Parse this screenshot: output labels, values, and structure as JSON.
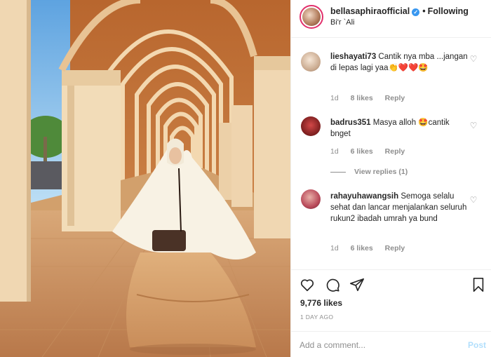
{
  "header": {
    "username": "bellasaphiraofficial",
    "separator": "•",
    "follow_status": "Following",
    "location": "Bi'r `Ali"
  },
  "comments": [
    {
      "username": "lieshayati73",
      "text": "Cantik nya mba ...jangan di lepas lagi yaa👏❤️❤️🤩",
      "time": "1d",
      "likes": "8 likes",
      "reply": "Reply"
    },
    {
      "username": "badrus351",
      "text": "Masya alloh 🤩cantik bnget",
      "time": "1d",
      "likes": "6 likes",
      "reply": "Reply",
      "view_replies": "View replies (1)"
    },
    {
      "username": "rahayuhawangsih",
      "text": "Semoga selalu sehat dan lancar menjalankan seluruh rukun2 ibadah umrah ya bund",
      "time": "1d",
      "likes": "6 likes",
      "reply": "Reply"
    }
  ],
  "post": {
    "likes": "9,776 likes",
    "time_ago": "1 DAY AGO"
  },
  "comment_box": {
    "placeholder": "Add a comment...",
    "post_label": "Post"
  },
  "icons": {
    "like": "heart-icon",
    "comment": "comment-icon",
    "share": "paper-plane-icon",
    "save": "bookmark-icon",
    "verified": "verified-badge-icon"
  },
  "colors": {
    "verified": "#3897f0",
    "muted": "#8e8e8e",
    "post_disabled": "#b2dffc",
    "story_ring": "#e1306c"
  }
}
